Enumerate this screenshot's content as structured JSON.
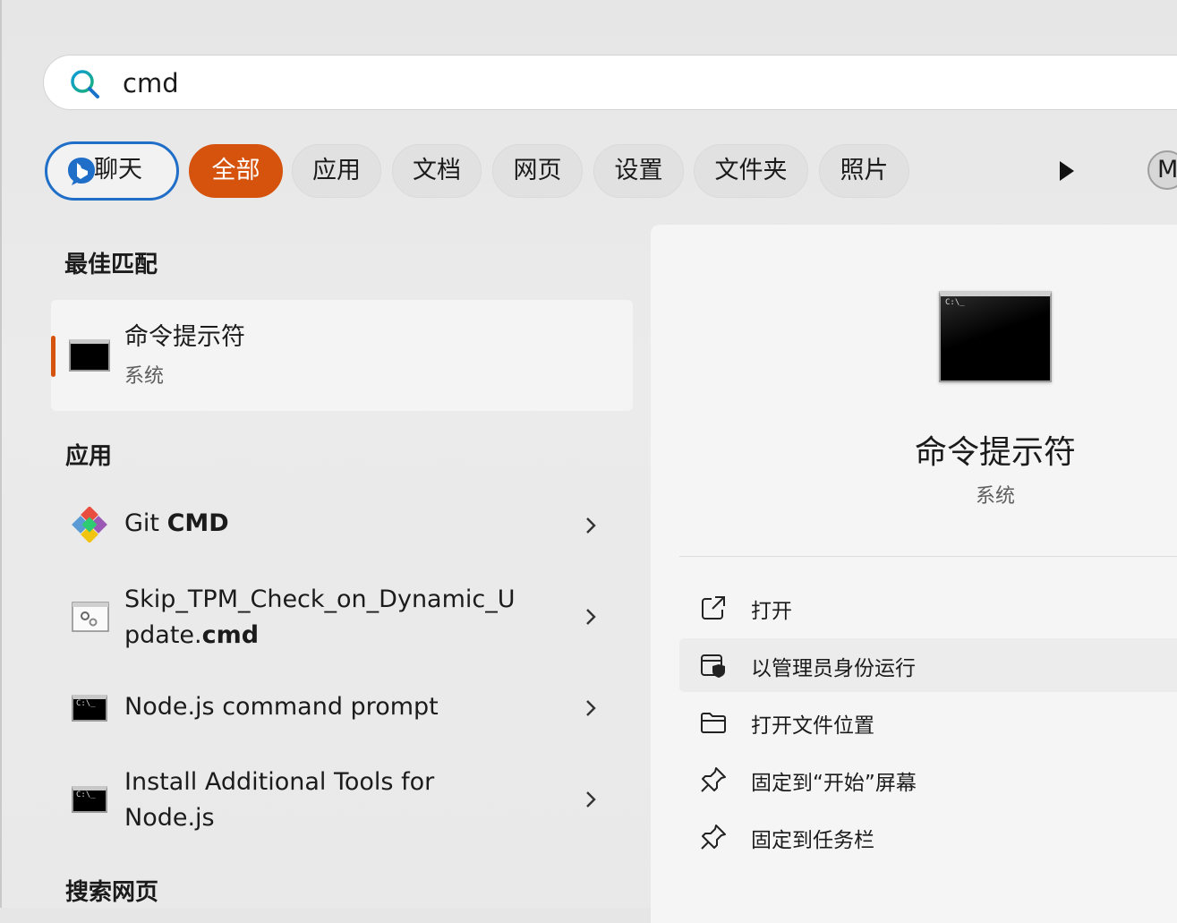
{
  "search": {
    "query": "cmd"
  },
  "filters": {
    "chat": "聊天",
    "tabs": [
      "全部",
      "应用",
      "文档",
      "网页",
      "设置",
      "文件夹",
      "照片"
    ],
    "active": "全部",
    "avatar_letter": "M"
  },
  "best_match": {
    "heading": "最佳匹配",
    "title": "命令提示符",
    "subtitle": "系统"
  },
  "apps": {
    "heading": "应用",
    "items": [
      {
        "prefix": "Git ",
        "bold": "CMD",
        "line2_prefix": "",
        "line2_bold": "",
        "icon": "git-icon"
      },
      {
        "prefix": "Skip_TPM_Check_on_Dynamic_U",
        "bold": "",
        "line2_prefix": "pdate.",
        "line2_bold": "cmd",
        "icon": "script-file-icon"
      },
      {
        "prefix": "Node.js command prompt",
        "bold": "",
        "line2_prefix": "",
        "line2_bold": "",
        "icon": "console-icon"
      },
      {
        "prefix": "Install Additional Tools for",
        "bold": "",
        "line2_prefix": "Node.js",
        "line2_bold": "",
        "icon": "console-icon"
      }
    ]
  },
  "web": {
    "heading": "搜索网页"
  },
  "preview": {
    "title": "命令提示符",
    "subtitle": "系统",
    "icon_prompt": "C:\\_",
    "actions": [
      {
        "label": "打开",
        "icon": "open-external-icon"
      },
      {
        "label": "以管理员身份运行",
        "icon": "shield-admin-icon"
      },
      {
        "label": "打开文件位置",
        "icon": "folder-icon"
      },
      {
        "label": "固定到“开始”屏幕",
        "icon": "pin-icon"
      },
      {
        "label": "固定到任务栏",
        "icon": "pin-icon"
      }
    ]
  },
  "colors": {
    "accent": "#d6530e",
    "chat_border": "#1f6ec7"
  }
}
